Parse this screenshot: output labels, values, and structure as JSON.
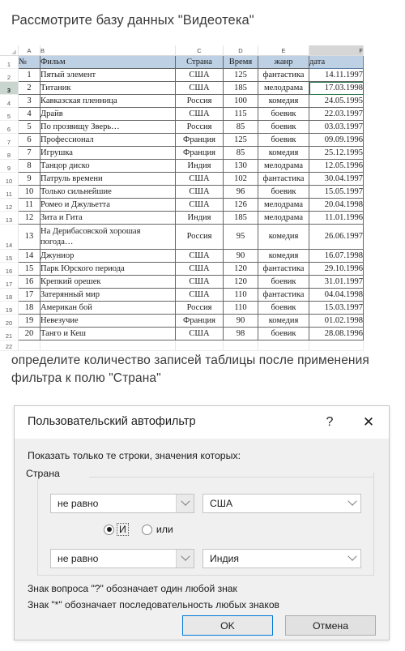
{
  "question": {
    "title": "Рассмотрите базу данных \"Видеотека\"",
    "middle": "определите количество записей таблицы после применения фильтра к полю \"Страна\""
  },
  "spreadsheet": {
    "column_letters": [
      "A",
      "B",
      "C",
      "D",
      "E",
      "F"
    ],
    "selected_column_letter": "F",
    "selected_row_number": "3",
    "selected_cell": "F3",
    "headers": {
      "num": "№",
      "film": "Фильм",
      "country": "Страна",
      "time": "Время",
      "genre": "жанр",
      "date": "дата"
    },
    "row_numbers": [
      "1",
      "2",
      "3",
      "4",
      "5",
      "6",
      "7",
      "8",
      "9",
      "10",
      "11",
      "12",
      "13",
      "14",
      "15",
      "16",
      "17",
      "18",
      "19",
      "20",
      "21",
      "22"
    ],
    "rows": [
      {
        "row": "2",
        "num": "1",
        "film": "Пятый элемент",
        "country": "США",
        "time": "125",
        "genre": "фантастика",
        "date": "14.11.1997"
      },
      {
        "row": "3",
        "num": "2",
        "film": "Титаник",
        "country": "США",
        "time": "185",
        "genre": "мелодрама",
        "date": "17.03.1998"
      },
      {
        "row": "4",
        "num": "3",
        "film": "Кавказская пленница",
        "country": "Россия",
        "time": "100",
        "genre": "комедия",
        "date": "24.05.1995"
      },
      {
        "row": "5",
        "num": "4",
        "film": "Драйв",
        "country": "США",
        "time": "115",
        "genre": "боевик",
        "date": "22.03.1997"
      },
      {
        "row": "6",
        "num": "5",
        "film": "По прозвищу Зверь…",
        "country": "Россия",
        "time": "85",
        "genre": "боевик",
        "date": "03.03.1997"
      },
      {
        "row": "7",
        "num": "6",
        "film": "Профессионал",
        "country": "Франция",
        "time": "125",
        "genre": "боевик",
        "date": "09.09.1996"
      },
      {
        "row": "8",
        "num": "7",
        "film": "Игрушка",
        "country": "Франция",
        "time": "85",
        "genre": "комедия",
        "date": "25.12.1995"
      },
      {
        "row": "9",
        "num": "8",
        "film": "Танцор диско",
        "country": "Индия",
        "time": "130",
        "genre": "мелодрама",
        "date": "12.05.1996"
      },
      {
        "row": "10",
        "num": "9",
        "film": "Патруль времени",
        "country": "США",
        "time": "102",
        "genre": "фантастика",
        "date": "30.04.1997"
      },
      {
        "row": "11",
        "num": "10",
        "film": "Только сильнейшие",
        "country": "США",
        "time": "96",
        "genre": "боевик",
        "date": "15.05.1997"
      },
      {
        "row": "12",
        "num": "11",
        "film": "Ромео и Джульетта",
        "country": "США",
        "time": "126",
        "genre": "мелодрама",
        "date": "20.04.1998"
      },
      {
        "row": "13",
        "num": "12",
        "film": "Зита и Гита",
        "country": "Индия",
        "time": "185",
        "genre": "мелодрама",
        "date": "11.01.1996"
      },
      {
        "row": "14",
        "num": "13",
        "film": "На Дерибасовской хорошая погода…",
        "country": "Россия",
        "time": "95",
        "genre": "комедия",
        "date": "26.06.1997",
        "tall": true
      },
      {
        "row": "15",
        "num": "14",
        "film": "Джуниор",
        "country": "США",
        "time": "90",
        "genre": "комедия",
        "date": "16.07.1998"
      },
      {
        "row": "16",
        "num": "15",
        "film": "Парк Юрского периода",
        "country": "США",
        "time": "120",
        "genre": "фантастика",
        "date": "29.10.1996"
      },
      {
        "row": "17",
        "num": "16",
        "film": "Крепкий орешек",
        "country": "США",
        "time": "120",
        "genre": "боевик",
        "date": "31.01.1997"
      },
      {
        "row": "18",
        "num": "17",
        "film": "Затерянный мир",
        "country": "США",
        "time": "110",
        "genre": "фантастика",
        "date": "04.04.1998"
      },
      {
        "row": "19",
        "num": "18",
        "film": "Американ бой",
        "country": "Россия",
        "time": "110",
        "genre": "боевик",
        "date": "15.03.1997"
      },
      {
        "row": "20",
        "num": "19",
        "film": "Невезучие",
        "country": "Франция",
        "time": "90",
        "genre": "комедия",
        "date": "01.02.1998"
      },
      {
        "row": "21",
        "num": "20",
        "film": "Танго и Кеш",
        "country": "США",
        "time": "98",
        "genre": "боевик",
        "date": "28.08.1996"
      }
    ]
  },
  "dialog": {
    "title": "Пользовательский автофильтр",
    "help_icon": "?",
    "close_icon": "✕",
    "lead": "Показать только те строки, значения которых:",
    "field_label": "Страна",
    "criteria": [
      {
        "operator": "не равно",
        "value": "США"
      },
      {
        "operator": "не равно",
        "value": "Индия"
      }
    ],
    "conjunction": {
      "and_label": "И",
      "or_label": "или",
      "selected": "И"
    },
    "hints": [
      "Знак вопроса \"?\" обозначает один любой знак",
      "Знак \"*\" обозначает последовательность любых знаков"
    ],
    "buttons": {
      "ok": "OK",
      "cancel": "Отмена"
    },
    "accent_color": "#0078d7"
  }
}
